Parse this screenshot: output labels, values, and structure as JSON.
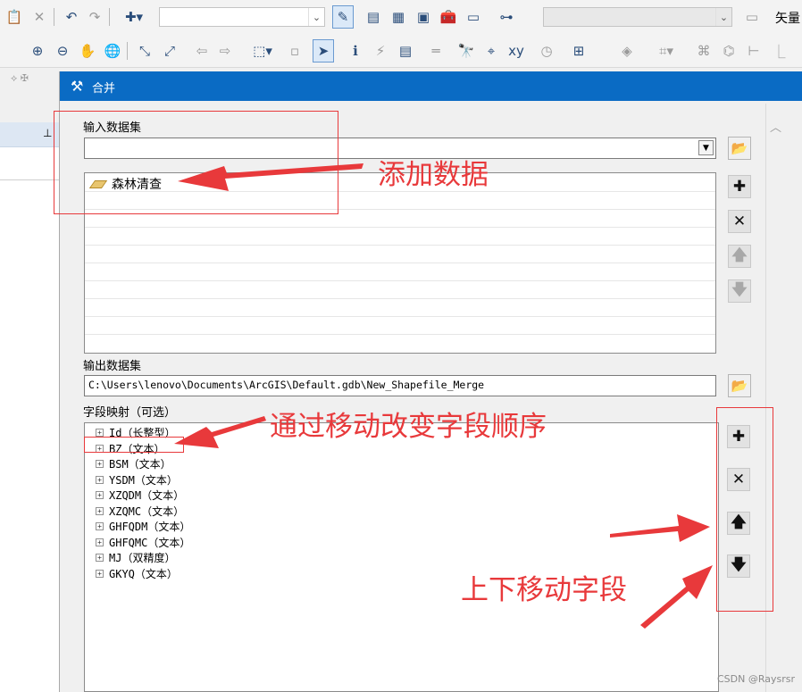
{
  "toolbar": {
    "right_label": "矢量"
  },
  "dialog": {
    "title": "合并",
    "input_label": "输入数据集",
    "input_items": [
      "森林清查"
    ],
    "output_label": "输出数据集",
    "output_path": "C:\\Users\\lenovo\\Documents\\ArcGIS\\Default.gdb\\New_Shapefile_Merge",
    "field_map_label": "字段映射（可选）",
    "fields": [
      "Id（长整型）",
      "BZ（文本）",
      "BSM（文本）",
      "YSDM（文本）",
      "XZQDM（文本）",
      "XZQMC（文本）",
      "GHFQDM（文本）",
      "GHFQMC（文本）",
      "MJ（双精度）",
      "GKYQ（文本）"
    ]
  },
  "annotations": {
    "add_data": "添加数据",
    "reorder": "通过移动改变字段顺序",
    "move_fields": "上下移动字段",
    "color": "#e8393b"
  },
  "watermark": "CSDN @Raysrsr",
  "colors": {
    "titlebar": "#0a6bc4",
    "accent_red": "#e8393b"
  }
}
